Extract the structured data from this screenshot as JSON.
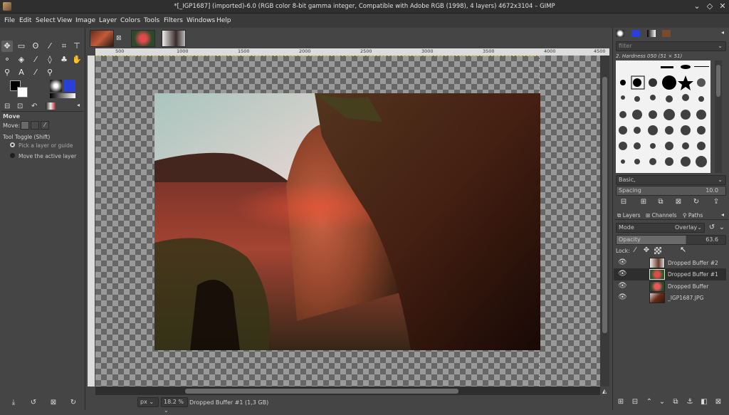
{
  "window": {
    "title": "*[_IGP1687] (imported)-6.0 (RGB color 8-bit gamma integer, Compatible with Adobe RGB (1998), 4 layers) 4672x3104 – GIMP"
  },
  "menu": [
    "File",
    "Edit",
    "Select",
    "View",
    "Image",
    "Layer",
    "Colors",
    "Tools",
    "Filters",
    "Windows",
    "Help"
  ],
  "tool_options": {
    "title": "Move",
    "move_label": "Move:",
    "toggle_label": "Tool Toggle  (Shift)",
    "option_pick": "Pick a layer or guide",
    "option_move": "Move the active layer"
  },
  "ruler": {
    "ticks": [
      "500",
      "1000",
      "1500",
      "2000",
      "2500",
      "3000",
      "3500",
      "4000",
      "4500"
    ]
  },
  "status": {
    "unit": "px",
    "zoom": "18.2 %",
    "message": "Dropped Buffer #1 (1,3 GB)"
  },
  "brushes": {
    "filter_placeholder": "filter",
    "selected_brush": "2. Hardness 050 (51 × 51)",
    "tag": "Basic,",
    "spacing_label": "Spacing",
    "spacing_value": "10.0"
  },
  "layers_panel": {
    "tabs": [
      "Layers",
      "Channels",
      "Paths"
    ],
    "mode_label": "Mode",
    "mode_value": "Overlay",
    "opacity_label": "Opacity",
    "opacity_value": "63.6",
    "lock_label": "Lock:",
    "layers": [
      {
        "name": "Dropped Buffer #2",
        "selected": false
      },
      {
        "name": "Dropped Buffer #1",
        "selected": true
      },
      {
        "name": "Dropped Buffer",
        "selected": false
      },
      {
        "name": "_IGP1687.JPG",
        "selected": false
      }
    ]
  },
  "colors": {
    "fg": "#000000",
    "bg": "#ffffff",
    "accent_blue": "#2a3fd8"
  }
}
